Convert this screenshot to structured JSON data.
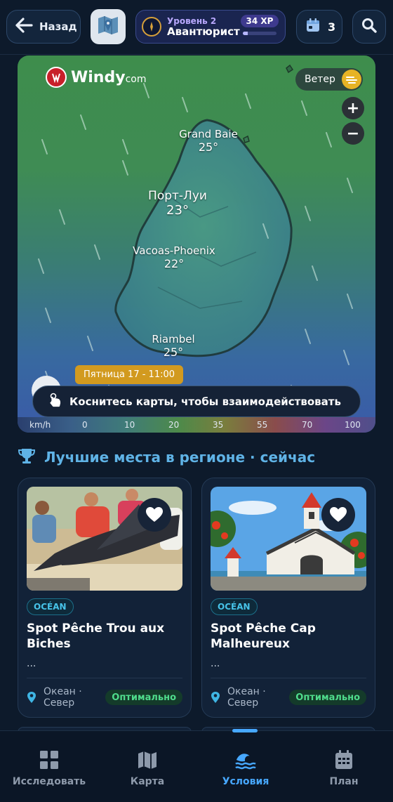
{
  "header": {
    "back_label": "Назад",
    "level_sub": "Уровень 2",
    "level_title": "Авантюрист",
    "xp_label": "34 XP",
    "xp_progress": 0.15,
    "calendar_count": "3"
  },
  "map": {
    "logo_text": "Windy",
    "logo_suffix": "com",
    "wind_toggle_label": "Ветер",
    "zoom_in": "+",
    "zoom_out": "−",
    "cities": [
      {
        "name": "Grand Baie",
        "temp": "25°"
      },
      {
        "name": "Порт-Луи",
        "temp": "23°"
      },
      {
        "name": "Vacoas-Phoenix",
        "temp": "22°"
      },
      {
        "name": "Riambel",
        "temp": "25°"
      }
    ],
    "time_label": "Пятница 17 - 11:00",
    "touch_hint": "Коснитесь карты, чтобы взаимодействовать",
    "scale_unit": "km/h",
    "scale_ticks": [
      "0",
      "10",
      "20",
      "35",
      "55",
      "70",
      "100"
    ]
  },
  "section": {
    "title": "Лучшие места в регионе · сейчас"
  },
  "cards": [
    {
      "tag": "OCÉAN",
      "title": "Spot Pêche Trou aux Biches",
      "ellipsis": "...",
      "location": "Океан · Север",
      "status": "Оптимально"
    },
    {
      "tag": "OCÉAN",
      "title": "Spot Pêche Cap Malheureux",
      "ellipsis": "...",
      "location": "Океан · Север",
      "status": "Оптимально"
    }
  ],
  "nav": {
    "items": [
      {
        "label": "Исследовать",
        "icon": "grid-icon"
      },
      {
        "label": "Карта",
        "icon": "map-icon"
      },
      {
        "label": "Условия",
        "icon": "waves-icon"
      },
      {
        "label": "План",
        "icon": "calendar-icon"
      }
    ],
    "active_index": 2
  },
  "colors": {
    "background": "#0d1a2b",
    "accent": "#47a8ff",
    "section_title": "#5fb3e6",
    "status_ok": "#4fdc8c",
    "date_pill": "#d29a1f"
  }
}
